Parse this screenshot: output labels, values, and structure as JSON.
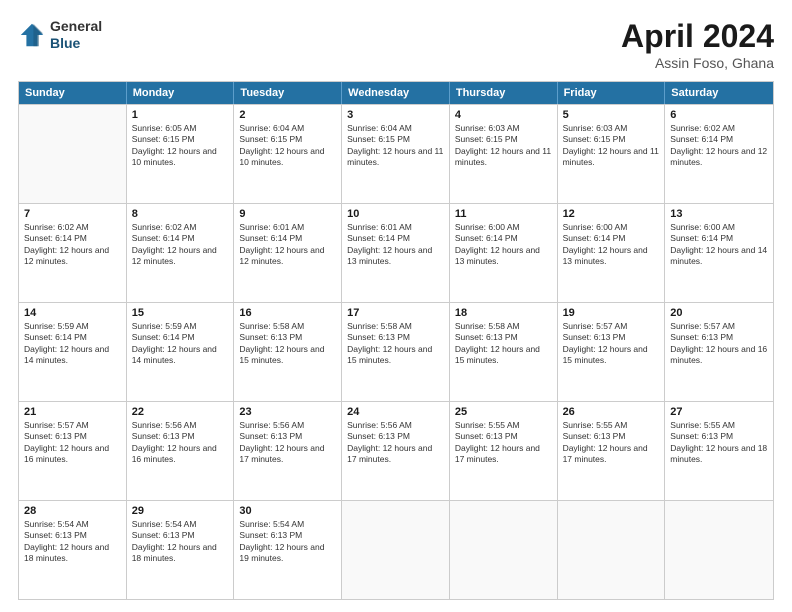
{
  "header": {
    "logo_general": "General",
    "logo_blue": "Blue",
    "title": "April 2024",
    "location": "Assin Foso, Ghana"
  },
  "calendar": {
    "weekdays": [
      "Sunday",
      "Monday",
      "Tuesday",
      "Wednesday",
      "Thursday",
      "Friday",
      "Saturday"
    ],
    "rows": [
      [
        {
          "day": "",
          "sunrise": "",
          "sunset": "",
          "daylight": "",
          "empty": true
        },
        {
          "day": "1",
          "sunrise": "Sunrise: 6:05 AM",
          "sunset": "Sunset: 6:15 PM",
          "daylight": "Daylight: 12 hours and 10 minutes."
        },
        {
          "day": "2",
          "sunrise": "Sunrise: 6:04 AM",
          "sunset": "Sunset: 6:15 PM",
          "daylight": "Daylight: 12 hours and 10 minutes."
        },
        {
          "day": "3",
          "sunrise": "Sunrise: 6:04 AM",
          "sunset": "Sunset: 6:15 PM",
          "daylight": "Daylight: 12 hours and 11 minutes."
        },
        {
          "day": "4",
          "sunrise": "Sunrise: 6:03 AM",
          "sunset": "Sunset: 6:15 PM",
          "daylight": "Daylight: 12 hours and 11 minutes."
        },
        {
          "day": "5",
          "sunrise": "Sunrise: 6:03 AM",
          "sunset": "Sunset: 6:15 PM",
          "daylight": "Daylight: 12 hours and 11 minutes."
        },
        {
          "day": "6",
          "sunrise": "Sunrise: 6:02 AM",
          "sunset": "Sunset: 6:14 PM",
          "daylight": "Daylight: 12 hours and 12 minutes."
        }
      ],
      [
        {
          "day": "7",
          "sunrise": "Sunrise: 6:02 AM",
          "sunset": "Sunset: 6:14 PM",
          "daylight": "Daylight: 12 hours and 12 minutes."
        },
        {
          "day": "8",
          "sunrise": "Sunrise: 6:02 AM",
          "sunset": "Sunset: 6:14 PM",
          "daylight": "Daylight: 12 hours and 12 minutes."
        },
        {
          "day": "9",
          "sunrise": "Sunrise: 6:01 AM",
          "sunset": "Sunset: 6:14 PM",
          "daylight": "Daylight: 12 hours and 12 minutes."
        },
        {
          "day": "10",
          "sunrise": "Sunrise: 6:01 AM",
          "sunset": "Sunset: 6:14 PM",
          "daylight": "Daylight: 12 hours and 13 minutes."
        },
        {
          "day": "11",
          "sunrise": "Sunrise: 6:00 AM",
          "sunset": "Sunset: 6:14 PM",
          "daylight": "Daylight: 12 hours and 13 minutes."
        },
        {
          "day": "12",
          "sunrise": "Sunrise: 6:00 AM",
          "sunset": "Sunset: 6:14 PM",
          "daylight": "Daylight: 12 hours and 13 minutes."
        },
        {
          "day": "13",
          "sunrise": "Sunrise: 6:00 AM",
          "sunset": "Sunset: 6:14 PM",
          "daylight": "Daylight: 12 hours and 14 minutes."
        }
      ],
      [
        {
          "day": "14",
          "sunrise": "Sunrise: 5:59 AM",
          "sunset": "Sunset: 6:14 PM",
          "daylight": "Daylight: 12 hours and 14 minutes."
        },
        {
          "day": "15",
          "sunrise": "Sunrise: 5:59 AM",
          "sunset": "Sunset: 6:14 PM",
          "daylight": "Daylight: 12 hours and 14 minutes."
        },
        {
          "day": "16",
          "sunrise": "Sunrise: 5:58 AM",
          "sunset": "Sunset: 6:13 PM",
          "daylight": "Daylight: 12 hours and 15 minutes."
        },
        {
          "day": "17",
          "sunrise": "Sunrise: 5:58 AM",
          "sunset": "Sunset: 6:13 PM",
          "daylight": "Daylight: 12 hours and 15 minutes."
        },
        {
          "day": "18",
          "sunrise": "Sunrise: 5:58 AM",
          "sunset": "Sunset: 6:13 PM",
          "daylight": "Daylight: 12 hours and 15 minutes."
        },
        {
          "day": "19",
          "sunrise": "Sunrise: 5:57 AM",
          "sunset": "Sunset: 6:13 PM",
          "daylight": "Daylight: 12 hours and 15 minutes."
        },
        {
          "day": "20",
          "sunrise": "Sunrise: 5:57 AM",
          "sunset": "Sunset: 6:13 PM",
          "daylight": "Daylight: 12 hours and 16 minutes."
        }
      ],
      [
        {
          "day": "21",
          "sunrise": "Sunrise: 5:57 AM",
          "sunset": "Sunset: 6:13 PM",
          "daylight": "Daylight: 12 hours and 16 minutes."
        },
        {
          "day": "22",
          "sunrise": "Sunrise: 5:56 AM",
          "sunset": "Sunset: 6:13 PM",
          "daylight": "Daylight: 12 hours and 16 minutes."
        },
        {
          "day": "23",
          "sunrise": "Sunrise: 5:56 AM",
          "sunset": "Sunset: 6:13 PM",
          "daylight": "Daylight: 12 hours and 17 minutes."
        },
        {
          "day": "24",
          "sunrise": "Sunrise: 5:56 AM",
          "sunset": "Sunset: 6:13 PM",
          "daylight": "Daylight: 12 hours and 17 minutes."
        },
        {
          "day": "25",
          "sunrise": "Sunrise: 5:55 AM",
          "sunset": "Sunset: 6:13 PM",
          "daylight": "Daylight: 12 hours and 17 minutes."
        },
        {
          "day": "26",
          "sunrise": "Sunrise: 5:55 AM",
          "sunset": "Sunset: 6:13 PM",
          "daylight": "Daylight: 12 hours and 17 minutes."
        },
        {
          "day": "27",
          "sunrise": "Sunrise: 5:55 AM",
          "sunset": "Sunset: 6:13 PM",
          "daylight": "Daylight: 12 hours and 18 minutes."
        }
      ],
      [
        {
          "day": "28",
          "sunrise": "Sunrise: 5:54 AM",
          "sunset": "Sunset: 6:13 PM",
          "daylight": "Daylight: 12 hours and 18 minutes."
        },
        {
          "day": "29",
          "sunrise": "Sunrise: 5:54 AM",
          "sunset": "Sunset: 6:13 PM",
          "daylight": "Daylight: 12 hours and 18 minutes."
        },
        {
          "day": "30",
          "sunrise": "Sunrise: 5:54 AM",
          "sunset": "Sunset: 6:13 PM",
          "daylight": "Daylight: 12 hours and 19 minutes."
        },
        {
          "day": "",
          "sunrise": "",
          "sunset": "",
          "daylight": "",
          "empty": true
        },
        {
          "day": "",
          "sunrise": "",
          "sunset": "",
          "daylight": "",
          "empty": true
        },
        {
          "day": "",
          "sunrise": "",
          "sunset": "",
          "daylight": "",
          "empty": true
        },
        {
          "day": "",
          "sunrise": "",
          "sunset": "",
          "daylight": "",
          "empty": true
        }
      ]
    ]
  }
}
